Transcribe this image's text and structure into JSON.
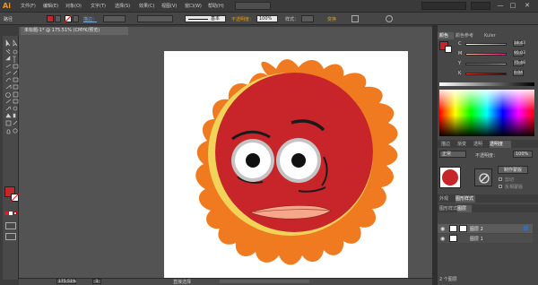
{
  "app": {
    "logo": "Ai"
  },
  "menu": [
    "文件(F)",
    "编辑(E)",
    "对象(O)",
    "文字(T)",
    "选择(S)",
    "效果(C)",
    "视图(V)",
    "窗口(W)",
    "帮助(H)"
  ],
  "window_buttons": [
    "—",
    "□",
    "✕"
  ],
  "control": {
    "selection": "路径",
    "stroke_label": "描边：",
    "profile": "基本",
    "opacity_label": "不透明度：",
    "opacity_value": "100%",
    "style_label": "样式：",
    "transform": "变换"
  },
  "document": {
    "tab": "未标题-1* @ 175.51% (CMYK/预览)",
    "close": "×"
  },
  "status": {
    "zoom": "175.51%",
    "page": "1",
    "tool": "直接选择"
  },
  "panel": {
    "color_tabs": [
      "颜色",
      "颜色参考",
      "Kuler"
    ],
    "channels": [
      {
        "label": "C",
        "value": "18.43"
      },
      {
        "label": "M",
        "value": "95.03"
      },
      {
        "label": "Y",
        "value": "75.48"
      },
      {
        "label": "K",
        "value": "0.04"
      }
    ],
    "icon_tabs": [
      "描边",
      "渐变",
      "透明",
      "透明度"
    ],
    "blend_mode": "正常",
    "opacity_label": "不透明度：",
    "opacity_value": "100%",
    "mask_button": "制作蒙版",
    "clip_label": "剪切",
    "invert_label": "反相蒙版",
    "layers_tabs": [
      "外观",
      "图形样式",
      "图层"
    ],
    "layers_active": "图层",
    "layers": [
      {
        "name": "图层 2",
        "selected": true
      },
      {
        "name": "图层 1",
        "selected": false
      }
    ],
    "layers_count": "2 个图层"
  },
  "colors": {
    "fill": "#c7252a",
    "accent": "#3f6ba8",
    "sun_orange": "#f07a20",
    "sun_red": "#c7252a"
  }
}
